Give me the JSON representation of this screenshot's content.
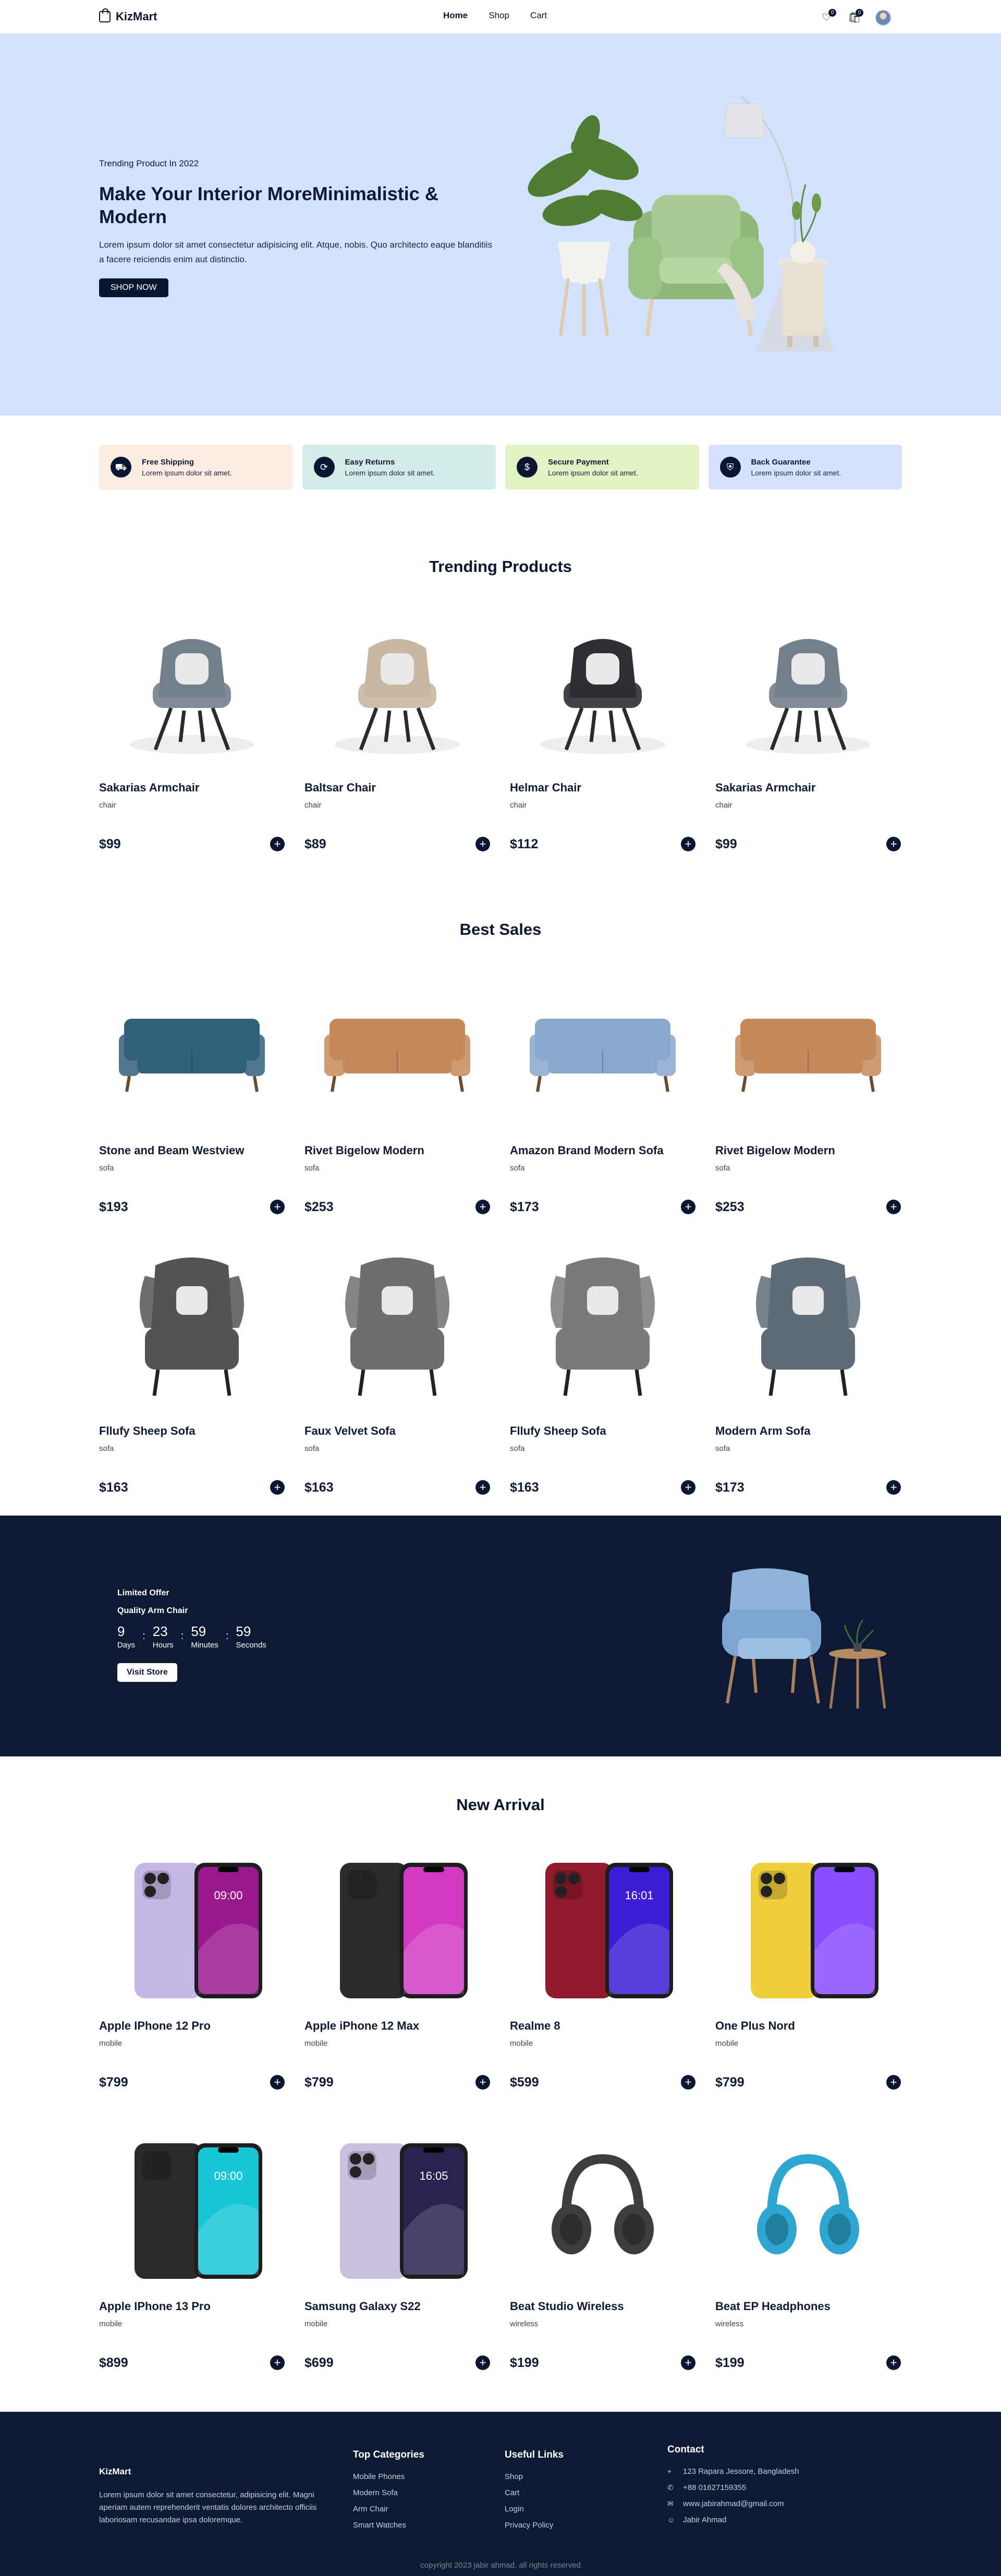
{
  "nav": {
    "brand": "KizMart",
    "links": [
      "Home",
      "Shop",
      "Cart"
    ],
    "wishlist_count": "0",
    "cart_count": "0"
  },
  "hero": {
    "kicker": "Trending Product In 2022",
    "title": "Make Your Interior MoreMinimalistic & Modern",
    "description": "Lorem ipsum dolor sit amet consectetur adipisicing elit. Atque, nobis. Quo architecto eaque blanditiis a facere reiciendis enim aut distinctio.",
    "button": "SHOP NOW"
  },
  "features": [
    {
      "title": "Free Shipping",
      "desc": "Lorem ipsum dolor sit amet.",
      "bg": "#fcebe0",
      "icon": "truck-icon"
    },
    {
      "title": "Easy Returns",
      "desc": "Lorem ipsum dolor sit amet.",
      "bg": "#d3ece7",
      "icon": "refresh-icon"
    },
    {
      "title": "Secure Payment",
      "desc": "Lorem ipsum dolor sit amet.",
      "bg": "#e3f2c5",
      "icon": "dollar-icon"
    },
    {
      "title": "Back Guarantee",
      "desc": "Lorem ipsum dolor sit amet.",
      "bg": "#d5e2fb",
      "icon": "shield-icon"
    }
  ],
  "trending": {
    "title": "Trending Products",
    "items": [
      {
        "name": "Sakarias Armchair",
        "cat": "chair",
        "price": "$99",
        "kind": "chair",
        "color": "#737f8d"
      },
      {
        "name": "Baltsar Chair",
        "cat": "chair",
        "price": "$89",
        "kind": "chair",
        "color": "#c8b8a2"
      },
      {
        "name": "Helmar Chair",
        "cat": "chair",
        "price": "$112",
        "kind": "chair",
        "color": "#2e2e33"
      },
      {
        "name": "Sakarias Armchair",
        "cat": "chair",
        "price": "$99",
        "kind": "chair",
        "color": "#737f8d"
      }
    ]
  },
  "best": {
    "title": "Best Sales",
    "items": [
      {
        "name": "Stone and Beam Westview",
        "cat": "sofa",
        "price": "$193",
        "kind": "sofa",
        "color": "#31607a"
      },
      {
        "name": "Rivet Bigelow Modern",
        "cat": "sofa",
        "price": "$253",
        "kind": "sofa",
        "color": "#c58a5b"
      },
      {
        "name": "Amazon Brand Modern Sofa",
        "cat": "sofa",
        "price": "$173",
        "kind": "sofa",
        "color": "#88a8cc"
      },
      {
        "name": "Rivet Bigelow Modern",
        "cat": "sofa",
        "price": "$253",
        "kind": "sofa",
        "color": "#c58a5b"
      },
      {
        "name": "Fllufy Sheep Sofa",
        "cat": "sofa",
        "price": "$163",
        "kind": "wingchair",
        "color": "#545454"
      },
      {
        "name": "Faux Velvet Sofa",
        "cat": "sofa",
        "price": "$163",
        "kind": "wingchair",
        "color": "#6e6e6e"
      },
      {
        "name": "Fllufy Sheep Sofa",
        "cat": "sofa",
        "price": "$163",
        "kind": "wingchair",
        "color": "#7a7a7a"
      },
      {
        "name": "Modern Arm Sofa",
        "cat": "sofa",
        "price": "$173",
        "kind": "wingchair",
        "color": "#5e6c7a"
      }
    ]
  },
  "offer": {
    "kicker": "Limited Offer",
    "subtitle": "Quality Arm Chair",
    "countdown": [
      {
        "n": "9",
        "l": "Days"
      },
      {
        "n": "23",
        "l": "Hours"
      },
      {
        "n": "59",
        "l": "Minutes"
      },
      {
        "n": "59",
        "l": "Seconds"
      }
    ],
    "button": "Visit Store"
  },
  "arrival": {
    "title": "New Arrival",
    "items": [
      {
        "name": "Apple IPhone 12 Pro",
        "cat": "mobile",
        "price": "$799",
        "kind": "phone",
        "color": "#c6b8e6",
        "screen": "#9a1a8d",
        "time": "09:00"
      },
      {
        "name": "Apple iPhone 12 Max",
        "cat": "mobile",
        "price": "$799",
        "kind": "phone",
        "color": "#2b2b2e",
        "screen": "#d23ac2",
        "time": ""
      },
      {
        "name": "Realme 8",
        "cat": "mobile",
        "price": "$599",
        "kind": "phone",
        "color": "#8e1a2c",
        "screen": "#3b1ed6",
        "time": "16:01"
      },
      {
        "name": "One Plus Nord",
        "cat": "mobile",
        "price": "$799",
        "kind": "phone",
        "color": "#f1cf3a",
        "screen": "#8a4dff",
        "time": ""
      },
      {
        "name": "Apple IPhone 13 Pro",
        "cat": "mobile",
        "price": "$899",
        "kind": "phone",
        "color": "#2a2a2d",
        "screen": "#19c6d8",
        "time": "09:00"
      },
      {
        "name": "Samsung Galaxy S22",
        "cat": "mobile",
        "price": "$699",
        "kind": "phone",
        "color": "#cbbfe0",
        "screen": "#2a2250",
        "time": "16:05"
      },
      {
        "name": "Beat Studio Wireless",
        "cat": "wireless",
        "price": "$199",
        "kind": "headphone",
        "color": "#3d3d40"
      },
      {
        "name": "Beat EP Headphones",
        "cat": "wireless",
        "price": "$199",
        "kind": "headphone",
        "color": "#2da7d1"
      }
    ]
  },
  "footer": {
    "brand": "KizMart",
    "desc": "Lorem ipsum dolor sit amet consectetur, adipisicing elit. Magni aperiam autem reprehenderit ventatis dolores architecto officiis laboriosam recusandae ipsa doloremque.",
    "categories_title": "Top Categories",
    "categories": [
      "Mobile Phones",
      "Modern Sofa",
      "Arm Chair",
      "Smart Watches"
    ],
    "links_title": "Useful Links",
    "links": [
      "Shop",
      "Cart",
      "Login",
      "Privacy Policy"
    ],
    "contact_title": "Contact",
    "contact": [
      "123 Rapara Jessore, Bangladesh",
      "+88 01627159355",
      "www.jabirahmad@gmail.com",
      "Jabir Ahmad"
    ],
    "copyright": "copyright 2023 jabir ahmad. all rights reserved"
  }
}
